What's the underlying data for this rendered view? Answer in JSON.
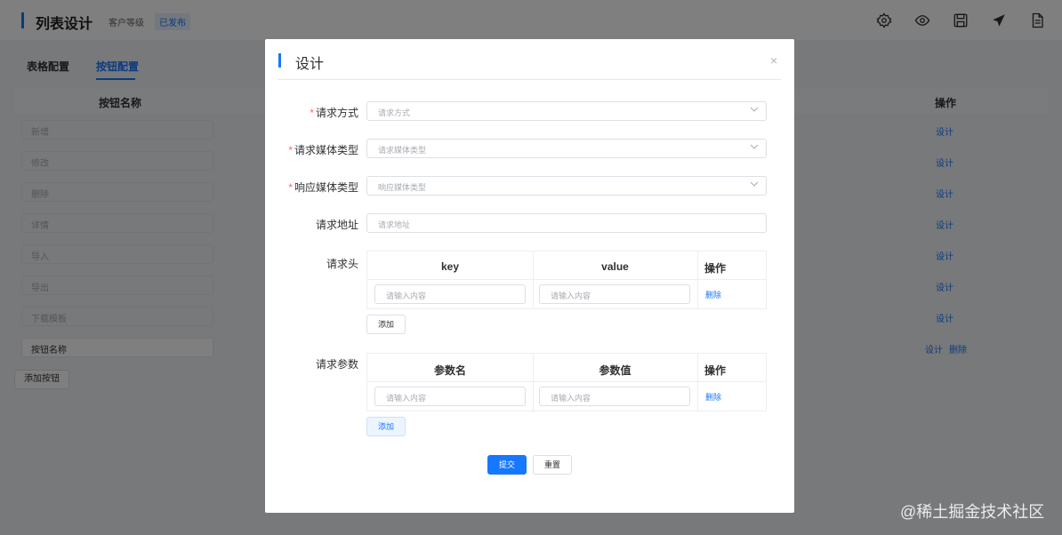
{
  "header": {
    "title": "列表设计",
    "subtitle": "客户等级",
    "status_badge": "已发布",
    "icons": [
      "gear-icon",
      "eye-icon",
      "save-icon",
      "send-icon",
      "document-icon"
    ]
  },
  "tabs": [
    {
      "label": "表格配置",
      "active": false
    },
    {
      "label": "按钮配置",
      "active": true
    }
  ],
  "button_table": {
    "col_name": "按钮名称",
    "col_action": "操作",
    "rows": [
      {
        "name": "新增",
        "action": "设计"
      },
      {
        "name": "修改",
        "action": "设计"
      },
      {
        "name": "删除",
        "action": "设计"
      },
      {
        "name": "详情",
        "action": "设计"
      },
      {
        "name": "导入",
        "action": "设计"
      },
      {
        "name": "导出",
        "action": "设计"
      },
      {
        "name": "下载模板",
        "action": "设计"
      }
    ],
    "new_row": {
      "name": "按钮名称",
      "action_design": "设计",
      "action_delete": "删除"
    },
    "add_label": "添加按钮"
  },
  "dialog": {
    "title": "设计",
    "close_symbol": "×",
    "request_method": {
      "label": "请求方式",
      "placeholder": "请求方式",
      "required": true
    },
    "request_media": {
      "label": "请求媒体类型",
      "placeholder": "请求媒体类型",
      "required": true
    },
    "response_media": {
      "label": "响应媒体类型",
      "placeholder": "响应媒体类型",
      "required": true
    },
    "request_url": {
      "label": "请求地址",
      "placeholder": "请求地址",
      "required": false
    },
    "headers": {
      "label": "请求头",
      "col_key": "key",
      "col_value": "value",
      "col_action": "操作",
      "key_placeholder": "请输入内容",
      "value_placeholder": "请输入内容",
      "delete_label": "删除",
      "add_label": "添加"
    },
    "params": {
      "label": "请求参数",
      "col_key": "参数名",
      "col_value": "参数值",
      "col_action": "操作",
      "key_placeholder": "请输入内容",
      "value_placeholder": "请输入内容",
      "delete_label": "删除",
      "add_label": "添加"
    },
    "submit_label": "提交",
    "reset_label": "重置"
  },
  "watermark": "@稀土掘金技术社区",
  "colors": {
    "accent": "#1677ff",
    "required": "#f56c6c",
    "overlay": "rgba(0,0,0,0.5)"
  }
}
